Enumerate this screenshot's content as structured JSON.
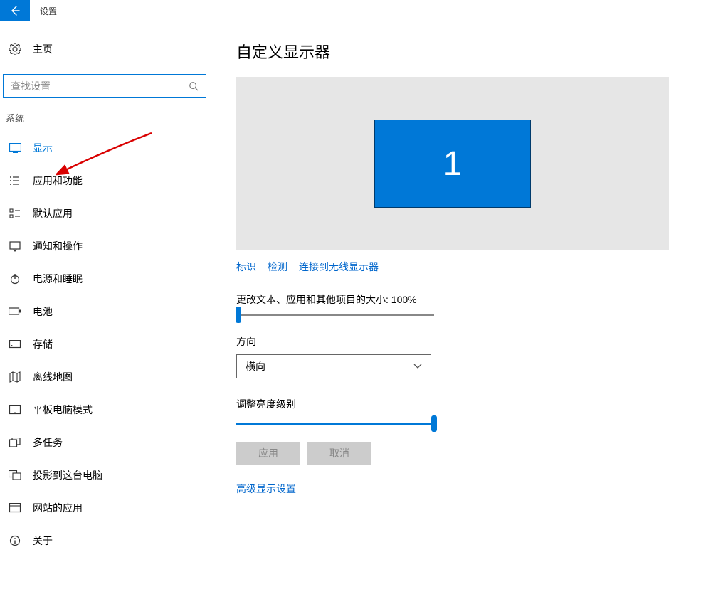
{
  "title_bar": {
    "text": "设置"
  },
  "sidebar": {
    "home": "主页",
    "search_placeholder": "查找设置",
    "section": "系统",
    "items": [
      {
        "label": "显示"
      },
      {
        "label": "应用和功能"
      },
      {
        "label": "默认应用"
      },
      {
        "label": "通知和操作"
      },
      {
        "label": "电源和睡眠"
      },
      {
        "label": "电池"
      },
      {
        "label": "存储"
      },
      {
        "label": "离线地图"
      },
      {
        "label": "平板电脑模式"
      },
      {
        "label": "多任务"
      },
      {
        "label": "投影到这台电脑"
      },
      {
        "label": "网站的应用"
      },
      {
        "label": "关于"
      }
    ]
  },
  "content": {
    "title": "自定义显示器",
    "monitor_number": "1",
    "links": {
      "identify": "标识",
      "detect": "检测",
      "wireless": "连接到无线显示器"
    },
    "scale_label": "更改文本、应用和其他项目的大小: 100%",
    "orientation_label": "方向",
    "orientation_value": "横向",
    "brightness_label": "调整亮度级别",
    "apply": "应用",
    "cancel": "取消",
    "advanced": "高级显示设置"
  }
}
